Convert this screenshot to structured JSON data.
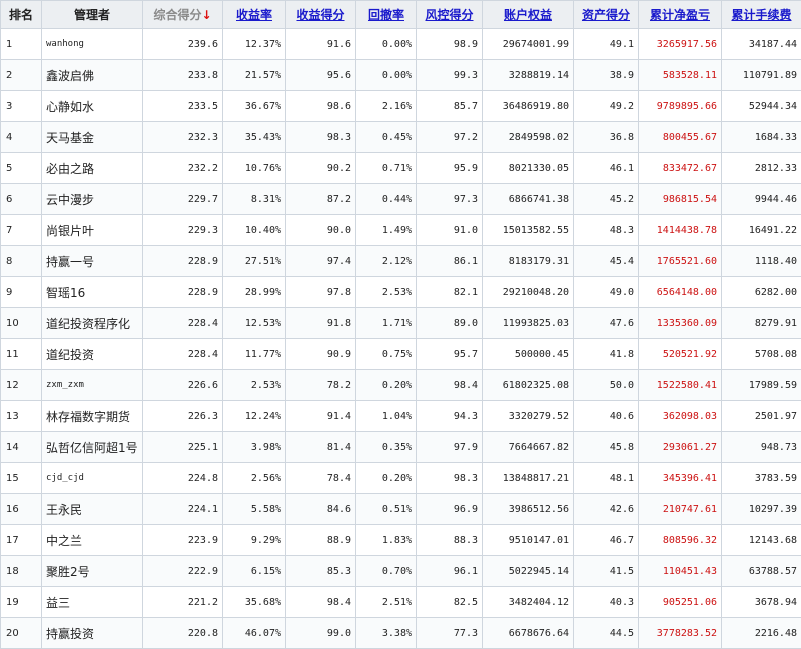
{
  "table": {
    "columns": [
      {
        "key": "rank",
        "label": "排名",
        "link": false,
        "sorted": false
      },
      {
        "key": "manager",
        "label": "管理者",
        "link": false,
        "sorted": false
      },
      {
        "key": "score",
        "label": "综合得分",
        "link": false,
        "sorted": true,
        "sort_arrow": "↓"
      },
      {
        "key": "return_rate",
        "label": "收益率",
        "link": true,
        "sorted": false
      },
      {
        "key": "return_score",
        "label": "收益得分",
        "link": true,
        "sorted": false
      },
      {
        "key": "drawdown",
        "label": "回撤率",
        "link": true,
        "sorted": false
      },
      {
        "key": "risk_score",
        "label": "风控得分",
        "link": true,
        "sorted": false
      },
      {
        "key": "equity",
        "label": "账户权益",
        "link": true,
        "sorted": false
      },
      {
        "key": "asset_score",
        "label": "资产得分",
        "link": true,
        "sorted": false
      },
      {
        "key": "net_profit",
        "label": "累计净盈亏",
        "link": true,
        "sorted": false
      },
      {
        "key": "fees",
        "label": "累计手续费",
        "link": true,
        "sorted": false
      }
    ],
    "rows": [
      {
        "rank": "1",
        "manager": "wanhong",
        "latin": true,
        "score": "239.6",
        "return_rate": "12.37%",
        "return_score": "91.6",
        "drawdown": "0.00%",
        "risk_score": "98.9",
        "equity": "29674001.99",
        "asset_score": "49.1",
        "net_profit": "3265917.56",
        "fees": "34187.44"
      },
      {
        "rank": "2",
        "manager": "鑫波启佛",
        "latin": false,
        "score": "233.8",
        "return_rate": "21.57%",
        "return_score": "95.6",
        "drawdown": "0.00%",
        "risk_score": "99.3",
        "equity": "3288819.14",
        "asset_score": "38.9",
        "net_profit": "583528.11",
        "fees": "110791.89"
      },
      {
        "rank": "3",
        "manager": "心静如水",
        "latin": false,
        "score": "233.5",
        "return_rate": "36.67%",
        "return_score": "98.6",
        "drawdown": "2.16%",
        "risk_score": "85.7",
        "equity": "36486919.80",
        "asset_score": "49.2",
        "net_profit": "9789895.66",
        "fees": "52944.34"
      },
      {
        "rank": "4",
        "manager": "天马基金",
        "latin": false,
        "score": "232.3",
        "return_rate": "35.43%",
        "return_score": "98.3",
        "drawdown": "0.45%",
        "risk_score": "97.2",
        "equity": "2849598.02",
        "asset_score": "36.8",
        "net_profit": "800455.67",
        "fees": "1684.33"
      },
      {
        "rank": "5",
        "manager": "必由之路",
        "latin": false,
        "score": "232.2",
        "return_rate": "10.76%",
        "return_score": "90.2",
        "drawdown": "0.71%",
        "risk_score": "95.9",
        "equity": "8021330.05",
        "asset_score": "46.1",
        "net_profit": "833472.67",
        "fees": "2812.33"
      },
      {
        "rank": "6",
        "manager": "云中漫步",
        "latin": false,
        "score": "229.7",
        "return_rate": "8.31%",
        "return_score": "87.2",
        "drawdown": "0.44%",
        "risk_score": "97.3",
        "equity": "6866741.38",
        "asset_score": "45.2",
        "net_profit": "986815.54",
        "fees": "9944.46"
      },
      {
        "rank": "7",
        "manager": "尚银片叶",
        "latin": false,
        "score": "229.3",
        "return_rate": "10.40%",
        "return_score": "90.0",
        "drawdown": "1.49%",
        "risk_score": "91.0",
        "equity": "15013582.55",
        "asset_score": "48.3",
        "net_profit": "1414438.78",
        "fees": "16491.22"
      },
      {
        "rank": "8",
        "manager": "持赢一号",
        "latin": false,
        "score": "228.9",
        "return_rate": "27.51%",
        "return_score": "97.4",
        "drawdown": "2.12%",
        "risk_score": "86.1",
        "equity": "8183179.31",
        "asset_score": "45.4",
        "net_profit": "1765521.60",
        "fees": "1118.40"
      },
      {
        "rank": "9",
        "manager": "智瑶16",
        "latin": false,
        "score": "228.9",
        "return_rate": "28.99%",
        "return_score": "97.8",
        "drawdown": "2.53%",
        "risk_score": "82.1",
        "equity": "29210048.20",
        "asset_score": "49.0",
        "net_profit": "6564148.00",
        "fees": "6282.00"
      },
      {
        "rank": "10",
        "manager": "道纪投资程序化",
        "latin": false,
        "score": "228.4",
        "return_rate": "12.53%",
        "return_score": "91.8",
        "drawdown": "1.71%",
        "risk_score": "89.0",
        "equity": "11993825.03",
        "asset_score": "47.6",
        "net_profit": "1335360.09",
        "fees": "8279.91"
      },
      {
        "rank": "11",
        "manager": "道纪投资",
        "latin": false,
        "score": "228.4",
        "return_rate": "11.77%",
        "return_score": "90.9",
        "drawdown": "0.75%",
        "risk_score": "95.7",
        "equity": "500000.45",
        "asset_score": "41.8",
        "net_profit": "520521.92",
        "fees": "5708.08"
      },
      {
        "rank": "12",
        "manager": "zxm_zxm",
        "latin": true,
        "score": "226.6",
        "return_rate": "2.53%",
        "return_score": "78.2",
        "drawdown": "0.20%",
        "risk_score": "98.4",
        "equity": "61802325.08",
        "asset_score": "50.0",
        "net_profit": "1522580.41",
        "fees": "17989.59"
      },
      {
        "rank": "13",
        "manager": "林存福数字期货",
        "latin": false,
        "score": "226.3",
        "return_rate": "12.24%",
        "return_score": "91.4",
        "drawdown": "1.04%",
        "risk_score": "94.3",
        "equity": "3320279.52",
        "asset_score": "40.6",
        "net_profit": "362098.03",
        "fees": "2501.97"
      },
      {
        "rank": "14",
        "manager": "弘哲亿信阿超1号",
        "latin": false,
        "score": "225.1",
        "return_rate": "3.98%",
        "return_score": "81.4",
        "drawdown": "0.35%",
        "risk_score": "97.9",
        "equity": "7664667.82",
        "asset_score": "45.8",
        "net_profit": "293061.27",
        "fees": "948.73"
      },
      {
        "rank": "15",
        "manager": "cjd_cjd",
        "latin": true,
        "score": "224.8",
        "return_rate": "2.56%",
        "return_score": "78.4",
        "drawdown": "0.20%",
        "risk_score": "98.3",
        "equity": "13848817.21",
        "asset_score": "48.1",
        "net_profit": "345396.41",
        "fees": "3783.59"
      },
      {
        "rank": "16",
        "manager": "王永民",
        "latin": false,
        "score": "224.1",
        "return_rate": "5.58%",
        "return_score": "84.6",
        "drawdown": "0.51%",
        "risk_score": "96.9",
        "equity": "3986512.56",
        "asset_score": "42.6",
        "net_profit": "210747.61",
        "fees": "10297.39"
      },
      {
        "rank": "17",
        "manager": "中之兰",
        "latin": false,
        "score": "223.9",
        "return_rate": "9.29%",
        "return_score": "88.9",
        "drawdown": "1.83%",
        "risk_score": "88.3",
        "equity": "9510147.01",
        "asset_score": "46.7",
        "net_profit": "808596.32",
        "fees": "12143.68"
      },
      {
        "rank": "18",
        "manager": "聚胜2号",
        "latin": false,
        "score": "222.9",
        "return_rate": "6.15%",
        "return_score": "85.3",
        "drawdown": "0.70%",
        "risk_score": "96.1",
        "equity": "5022945.14",
        "asset_score": "41.5",
        "net_profit": "110451.43",
        "fees": "63788.57"
      },
      {
        "rank": "19",
        "manager": "益三",
        "latin": false,
        "score": "221.2",
        "return_rate": "35.68%",
        "return_score": "98.4",
        "drawdown": "2.51%",
        "risk_score": "82.5",
        "equity": "3482404.12",
        "asset_score": "40.3",
        "net_profit": "905251.06",
        "fees": "3678.94"
      },
      {
        "rank": "20",
        "manager": "持赢投资",
        "latin": false,
        "score": "220.8",
        "return_rate": "46.07%",
        "return_score": "99.0",
        "drawdown": "3.38%",
        "risk_score": "77.3",
        "equity": "6678676.64",
        "asset_score": "44.5",
        "net_profit": "3778283.52",
        "fees": "2216.48"
      }
    ]
  },
  "colors": {
    "header_bg": "#eceff2",
    "link": "#1a1acc",
    "profit": "#cc1111",
    "sort_arrow": "#dd1111",
    "border": "#cfd6de"
  }
}
